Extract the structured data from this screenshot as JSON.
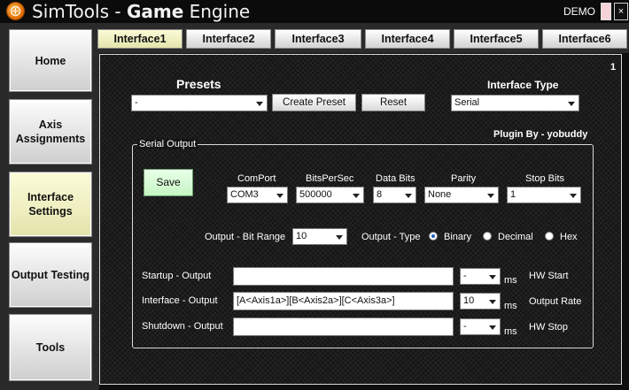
{
  "window": {
    "title_light": "SimTools - ",
    "title_bold": "Game",
    "title_rest": " Engine",
    "mode_label": "DEMO",
    "close_glyph": "×"
  },
  "sidebar": {
    "items": [
      {
        "label": "Home"
      },
      {
        "label": "Axis Assignments"
      },
      {
        "label": "Interface Settings",
        "active": true
      },
      {
        "label": "Output Testing"
      },
      {
        "label": "Tools"
      }
    ]
  },
  "tabs": [
    {
      "label": "Interface1",
      "active": true
    },
    {
      "label": "Interface2"
    },
    {
      "label": "Interface3"
    },
    {
      "label": "Interface4"
    },
    {
      "label": "Interface5"
    },
    {
      "label": "Interface6"
    }
  ],
  "panel": {
    "interface_number": "1",
    "presets_title": "Presets",
    "presets_value": "-",
    "create_preset_label": "Create Preset",
    "reset_label": "Reset",
    "interface_type_title": "Interface Type",
    "interface_type_value": "Serial",
    "plugin_by": "Plugin By - yobuddy"
  },
  "serial": {
    "group_title": "Serial Output",
    "save_label": "Save",
    "comport_label": "ComPort",
    "comport_value": "COM3",
    "bps_label": "BitsPerSec",
    "bps_value": "500000",
    "databits_label": "Data Bits",
    "databits_value": "8",
    "parity_label": "Parity",
    "parity_value": "None",
    "stopbits_label": "Stop Bits",
    "stopbits_value": "1",
    "bitrange_label": "Output - Bit Range",
    "bitrange_value": "10",
    "outtype_label": "Output - Type",
    "type_binary": "Binary",
    "type_decimal": "Decimal",
    "type_hex": "Hex",
    "selected_type": "Binary",
    "startup_label": "Startup - Output",
    "startup_value": "",
    "startup_ms_value": "-",
    "interface_label": "Interface - Output",
    "interface_value": "[A<Axis1a>][B<Axis2a>][C<Axis3a>]",
    "interface_ms_value": "10",
    "shutdown_label": "Shutdown - Output",
    "shutdown_value": "",
    "shutdown_ms_value": "-",
    "ms_unit": "ms",
    "hw_start_label": "HW Start",
    "output_rate_label": "Output Rate",
    "hw_stop_label": "HW Stop"
  },
  "icons": {
    "app_logo": "app-logo-icon",
    "dropdown_arrow": "chevron-down-icon"
  }
}
